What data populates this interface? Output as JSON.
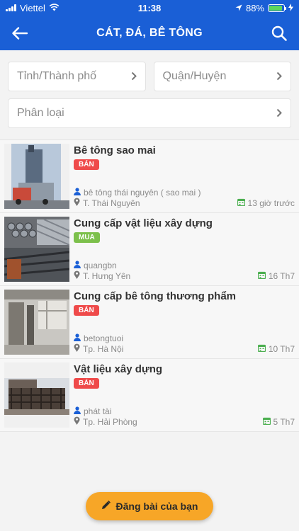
{
  "status_bar": {
    "carrier": "Viettel",
    "time": "11:38",
    "battery": "88%"
  },
  "header": {
    "title": "CÁT, ĐÁ, BÊ TÔNG",
    "back_icon": "arrow-left-icon",
    "search_icon": "search-icon"
  },
  "filters": {
    "province": "Tỉnh/Thành phố",
    "district": "Quận/Huyện",
    "category": "Phân loại"
  },
  "listings": [
    {
      "title": "Bê tông sao mai",
      "badge": "BÁN",
      "user": "bê tông thái nguyên ( sao mai )",
      "location": "T. Thái Nguyên",
      "time": "13 giờ trước"
    },
    {
      "title": "Cung cấp vật liệu xây dựng",
      "badge": "MUA",
      "user": "quangbn",
      "location": "T. Hưng Yên",
      "time": "16 Th7"
    },
    {
      "title": "Cung cấp bê tông thương phẩm",
      "badge": "BÁN",
      "user": "betongtuoi",
      "location": "Tp. Hà Nội",
      "time": "10 Th7"
    },
    {
      "title": "Vật liệu xây dựng",
      "badge": "BÁN",
      "user": "phát tài",
      "location": "Tp. Hải Phòng",
      "time": "5 Th7"
    }
  ],
  "post_button": {
    "label": "Đăng bài của bạn",
    "icon": "pencil-icon"
  },
  "colors": {
    "header": "#1a5fd6",
    "sell_badge": "#ef4a4a",
    "buy_badge": "#7cc04b",
    "fab": "#f7a627"
  }
}
